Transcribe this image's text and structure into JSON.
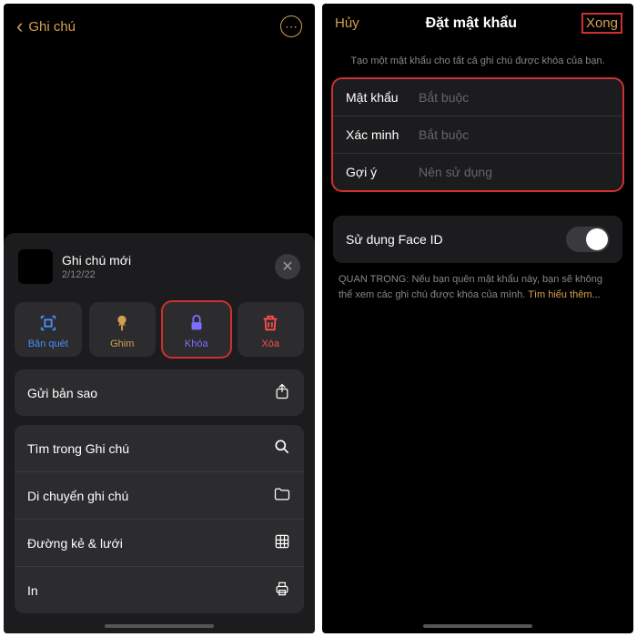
{
  "left": {
    "header_back": "Ghi chú",
    "note_title": "Ghi chú mới",
    "note_date": "2/12/22",
    "actions": {
      "scan": "Bản quét",
      "pin": "Ghim",
      "lock": "Khóa",
      "delete": "Xóa"
    },
    "menu": {
      "send_copy": "Gửi bản sao",
      "find": "Tìm trong Ghi chú",
      "move": "Di chuyển ghi chú",
      "lines": "Đường kẻ & lưới",
      "print": "In"
    }
  },
  "right": {
    "cancel": "Hủy",
    "title": "Đặt mật khẩu",
    "done": "Xong",
    "subtitle": "Tạo một mật khẩu cho tất cả ghi chú được khóa của bạn.",
    "fields": {
      "password_label": "Mật khẩu",
      "password_ph": "Bắt buộc",
      "verify_label": "Xác minh",
      "verify_ph": "Bắt buộc",
      "hint_label": "Gợi ý",
      "hint_ph": "Nên sử dụng"
    },
    "faceid": "Sử dụng Face ID",
    "warning": "QUAN TRỌNG: Nếu bạn quên mật khẩu này, bạn sẽ không thể xem các ghi chú được khóa của mình.",
    "warning_link": "Tìm hiểu thêm..."
  }
}
